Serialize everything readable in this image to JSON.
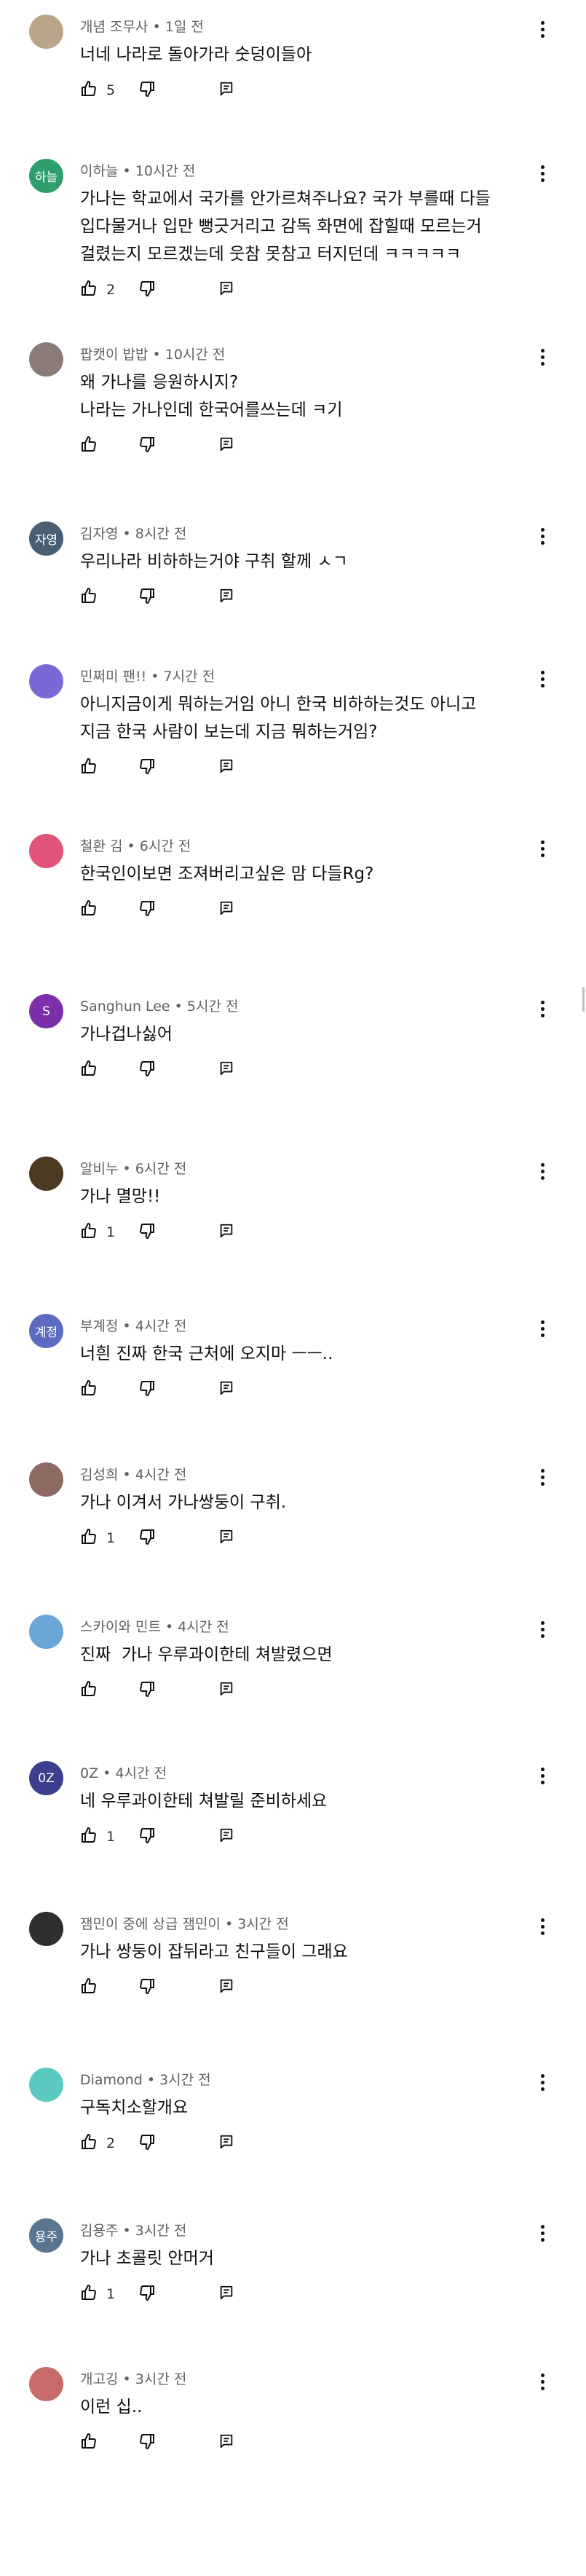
{
  "icons": {
    "like": "thumb-up-icon",
    "dislike": "thumb-down-icon",
    "reply": "reply-icon",
    "more": "more-vert-icon"
  },
  "comments": [
    {
      "author": "개념 조무사",
      "time": "1일 전",
      "text": "너네 나라로 돌아가라 숫덩이들아",
      "likes": "5",
      "avatar": {
        "label": "",
        "color": "#b9a58a"
      }
    },
    {
      "author": "이하늘",
      "time": "10시간 전",
      "text": "가나는 학교에서 국가를 안가르쳐주나요? 국가 부를때 다들\n입다물거나 입만 뻥긋거리고 감독 화면에 잡힐때 모르는거\n걸렸는지 모르겠는데 웃참 못참고 터지던데 ㅋㅋㅋㅋㅋ",
      "likes": "2",
      "avatar": {
        "label": "하늘",
        "color": "#2e9e6b"
      }
    },
    {
      "author": "팝캣이 밥밥",
      "time": "10시간 전",
      "text": "왜 가나를 응원하시지?\n나라는 가나인데 한국어를쓰는데 ㅋ기",
      "likes": "",
      "avatar": {
        "label": "",
        "color": "#8a7b78"
      }
    },
    {
      "author": "김자영",
      "time": "8시간 전",
      "text": "우리나라 비하하는거야 구취 할께 ㅅㄱ",
      "likes": "",
      "avatar": {
        "label": "자영",
        "color": "#4a5f73"
      }
    },
    {
      "author": "민쩌미 팬!!",
      "time": "7시간 전",
      "text": "아니지금이게 뭐하는거임 아니 한국 비하하는것도 아니고\n지금 한국 사람이 보는데 지금 뭐하는거임?",
      "likes": "",
      "avatar": {
        "label": "",
        "color": "#7b68d6"
      }
    },
    {
      "author": "철환 김",
      "time": "6시간 전",
      "text": "한국인이보면 조져버리고싶은 맘 다들Rg?",
      "likes": "",
      "avatar": {
        "label": "",
        "color": "#e2537a"
      }
    },
    {
      "author": "Sanghun Lee",
      "time": "5시간 전",
      "text": "가나겁나싫어",
      "likes": "",
      "avatar": {
        "label": "S",
        "color": "#7b2fa8"
      }
    },
    {
      "author": "알비누",
      "time": "6시간 전",
      "text": "가나 멸망!!",
      "likes": "1",
      "avatar": {
        "label": "",
        "color": "#4c3b22"
      }
    },
    {
      "author": "부계정",
      "time": "4시간 전",
      "text": "너흰 진짜 한국 근처에 오지마 ㅡㅡ..",
      "likes": "",
      "avatar": {
        "label": "계정",
        "color": "#5c6bc0"
      }
    },
    {
      "author": "김성희",
      "time": "4시간 전",
      "text": "가나 이겨서 가나쌍둥이 구취.",
      "likes": "1",
      "avatar": {
        "label": "",
        "color": "#8c6a62"
      }
    },
    {
      "author": "스카이와 민트",
      "time": "4시간 전",
      "text": "진짜  가나 우루과이한테 쳐발렸으면",
      "likes": "",
      "avatar": {
        "label": "",
        "color": "#6aa6d8"
      }
    },
    {
      "author": "0Z",
      "time": "4시간 전",
      "text": "네 우루과이한테 쳐발릴 준비하세요",
      "likes": "1",
      "avatar": {
        "label": "0Z",
        "color": "#3b3f8f"
      }
    },
    {
      "author": "잼민이 중에 상급 잼민이",
      "time": "3시간 전",
      "text": "가나 쌍둥이 잡뒤라고 친구들이 그래요",
      "likes": "",
      "avatar": {
        "label": "",
        "color": "#2f2f2f"
      }
    },
    {
      "author": "Diamond",
      "time": "3시간 전",
      "text": "구독치소할개요",
      "likes": "2",
      "avatar": {
        "label": "",
        "color": "#5cc9c0"
      }
    },
    {
      "author": "김용주",
      "time": "3시간 전",
      "text": "가나 초콜릿 안머거",
      "likes": "1",
      "avatar": {
        "label": "용주",
        "color": "#5a7590"
      }
    },
    {
      "author": "개고깅",
      "time": "3시간 전",
      "text": "이런 십..",
      "likes": "",
      "avatar": {
        "label": "",
        "color": "#c96a6a"
      }
    }
  ]
}
